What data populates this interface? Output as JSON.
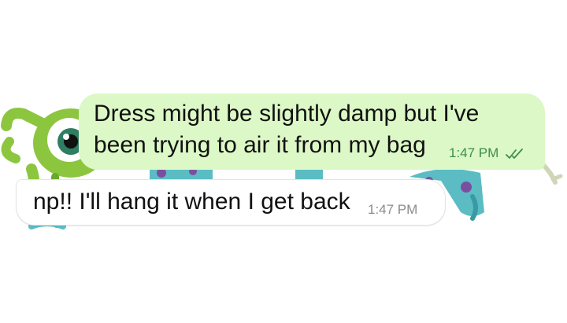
{
  "messages": [
    {
      "direction": "outgoing",
      "lines": [
        "Dress might be slightly damp but I've",
        "been trying to air it from my bag"
      ],
      "time": "1:47 PM",
      "status_icon": "double-check-read-icon"
    },
    {
      "direction": "incoming",
      "text": "np!! I'll hang it when I get back",
      "time": "1:47 PM"
    }
  ],
  "colors": {
    "outgoing_bubble": "#dcf8c6",
    "incoming_bubble": "#ffffff",
    "timestamp_outgoing": "#3c8d4d",
    "timestamp_incoming": "#8b8b8b",
    "wallpaper_green": "#8cc63f",
    "wallpaper_teal": "#5bbcc4"
  },
  "wallpaper": {
    "icon": "cartoon-monster-wallpaper-icon"
  }
}
